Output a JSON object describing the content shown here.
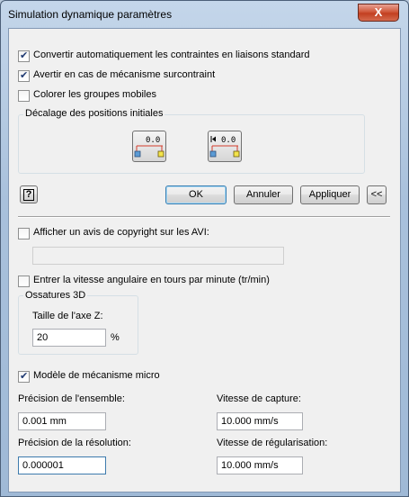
{
  "window": {
    "title": "Simulation dynamique paramètres",
    "close_glyph": "X"
  },
  "options": {
    "convert": {
      "label": "Convertir automatiquement les contraintes en liaisons standard",
      "checked": true
    },
    "warn": {
      "label": "Avertir en cas de mécanisme surcontraint",
      "checked": true
    },
    "color": {
      "label": "Colorer les groupes mobiles",
      "checked": false
    }
  },
  "offset_group": {
    "title": "Décalage des positions initiales",
    "button1_value": "0.0",
    "button2_value": "0.0"
  },
  "buttons": {
    "help": "?",
    "ok": "OK",
    "cancel": "Annuler",
    "apply": "Appliquer",
    "collapse": "<<"
  },
  "copyright": {
    "label": "Afficher un avis de copyright sur les AVI:",
    "checked": false,
    "value": ""
  },
  "angular": {
    "label": "Entrer la vitesse angulaire en tours par minute (tr/min)",
    "checked": false
  },
  "frames_group": {
    "title": "Ossatures 3D",
    "z_axis_label": "Taille de l'axe Z:",
    "z_axis_value": "20",
    "unit": "%"
  },
  "micro": {
    "label": "Modèle de mécanisme micro",
    "checked": true
  },
  "fields": {
    "precision_label": "Précision de l'ensemble:",
    "precision_value": "0.001 mm",
    "capture_label": "Vitesse de capture:",
    "capture_value": "10.000 mm/s",
    "resolution_label": "Précision de la résolution:",
    "resolution_value": "0.000001",
    "regularisation_label": "Vitesse de régularisation:",
    "regularisation_value": "10.000 mm/s"
  },
  "colors": {
    "marker_blue": "#5b9bd5",
    "marker_yellow": "#f3e34a",
    "accent_red": "#d23c2c"
  }
}
